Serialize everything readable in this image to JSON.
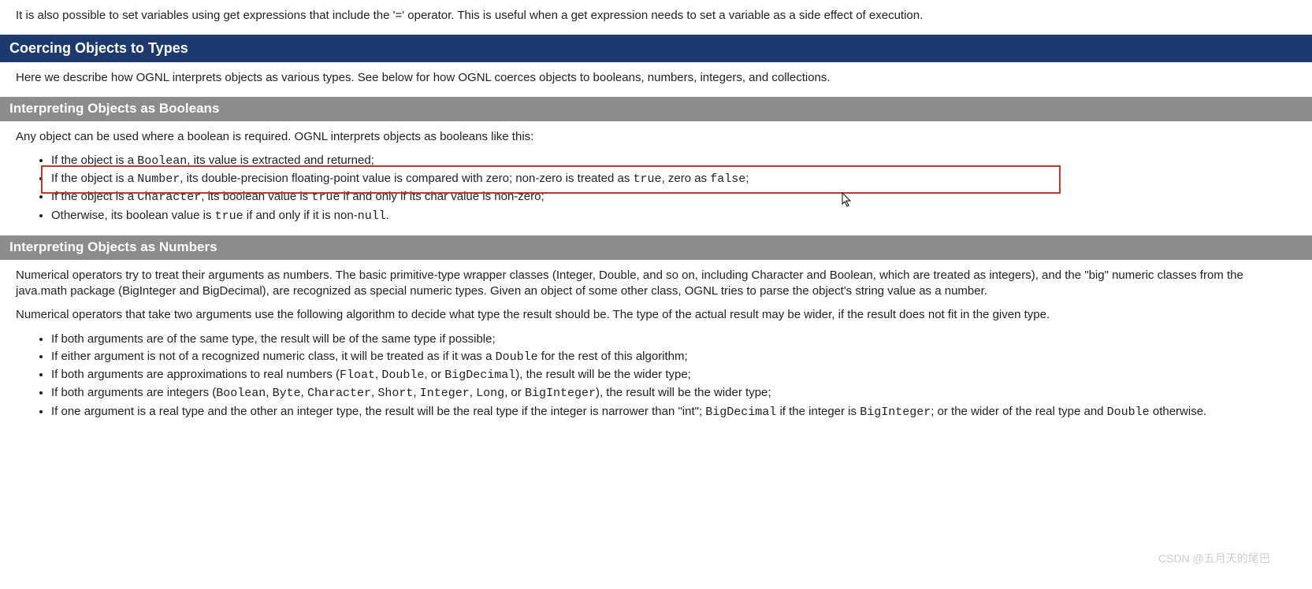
{
  "intro": "It is also possible to set variables using get expressions that include the '=' operator. This is useful when a get expression needs to set a variable as a side effect of execution.",
  "section1": {
    "title": "Coercing Objects to Types",
    "desc": "Here we describe how OGNL interprets objects as various types. See below for how OGNL coerces objects to booleans, numbers, integers, and collections."
  },
  "section2": {
    "title": "Interpreting Objects as Booleans",
    "desc": "Any object can be used where a boolean is required. OGNL interprets objects as booleans like this:",
    "items": {
      "b1_pre": "If the object is a ",
      "b1_code": "Boolean",
      "b1_post": ", its value is extracted and returned;",
      "b2_pre": "If the object is a ",
      "b2_code": "Number",
      "b2_mid": ", its double-precision floating-point value is compared with zero; non-zero is treated as ",
      "b2_c2": "true",
      "b2_mid2": ", zero as ",
      "b2_c3": "false",
      "b2_post": ";",
      "b3_pre": "If the object is a ",
      "b3_code": "Character",
      "b3_mid": ", its boolean value is ",
      "b3_c2": "true",
      "b3_post": " if and only if its char value is non-zero;",
      "b4_pre": "Otherwise, its boolean value is ",
      "b4_c1": "true",
      "b4_mid": " if and only if it is non-",
      "b4_c2": "null",
      "b4_post": "."
    }
  },
  "section3": {
    "title": "Interpreting Objects as Numbers",
    "p1": "Numerical operators try to treat their arguments as numbers. The basic primitive-type wrapper classes (Integer, Double, and so on, including Character and Boolean, which are treated as integers), and the \"big\" numeric classes from the java.math package (BigInteger and BigDecimal), are recognized as special numeric types. Given an object of some other class, OGNL tries to parse the object's string value as a number.",
    "p2": "Numerical operators that take two arguments use the following algorithm to decide what type the result should be. The type of the actual result may be wider, if the result does not fit in the given type.",
    "items": {
      "n1": "If both arguments are of the same type, the result will be of the same type if possible;",
      "n2_pre": "If either argument is not of a recognized numeric class, it will be treated as if it was a ",
      "n2_c1": "Double",
      "n2_post": " for the rest of this algorithm;",
      "n3_pre": "If both arguments are approximations to real numbers (",
      "n3_c1": "Float",
      "n3_s1": ", ",
      "n3_c2": "Double",
      "n3_s2": ", or ",
      "n3_c3": "BigDecimal",
      "n3_post": "), the result will be the wider type;",
      "n4_pre": "If both arguments are integers (",
      "n4_c1": "Boolean",
      "n4_s1": ", ",
      "n4_c2": "Byte",
      "n4_s2": ", ",
      "n4_c3": "Character",
      "n4_s3": ", ",
      "n4_c4": "Short",
      "n4_s4": ", ",
      "n4_c5": "Integer",
      "n4_s5": ", ",
      "n4_c6": "Long",
      "n4_s6": ", or ",
      "n4_c7": "BigInteger",
      "n4_post": "), the result will be the wider type;",
      "n5_pre": "If one argument is a real type and the other an integer type, the result will be the real type if the integer is narrower than \"int\"; ",
      "n5_c1": "BigDecimal",
      "n5_mid1": " if the integer is ",
      "n5_c2": "BigInteger",
      "n5_mid2": "; or the wider of the real type and ",
      "n5_c3": "Double",
      "n5_post": " otherwise."
    }
  },
  "watermark": "CSDN @五月天的尾巴"
}
